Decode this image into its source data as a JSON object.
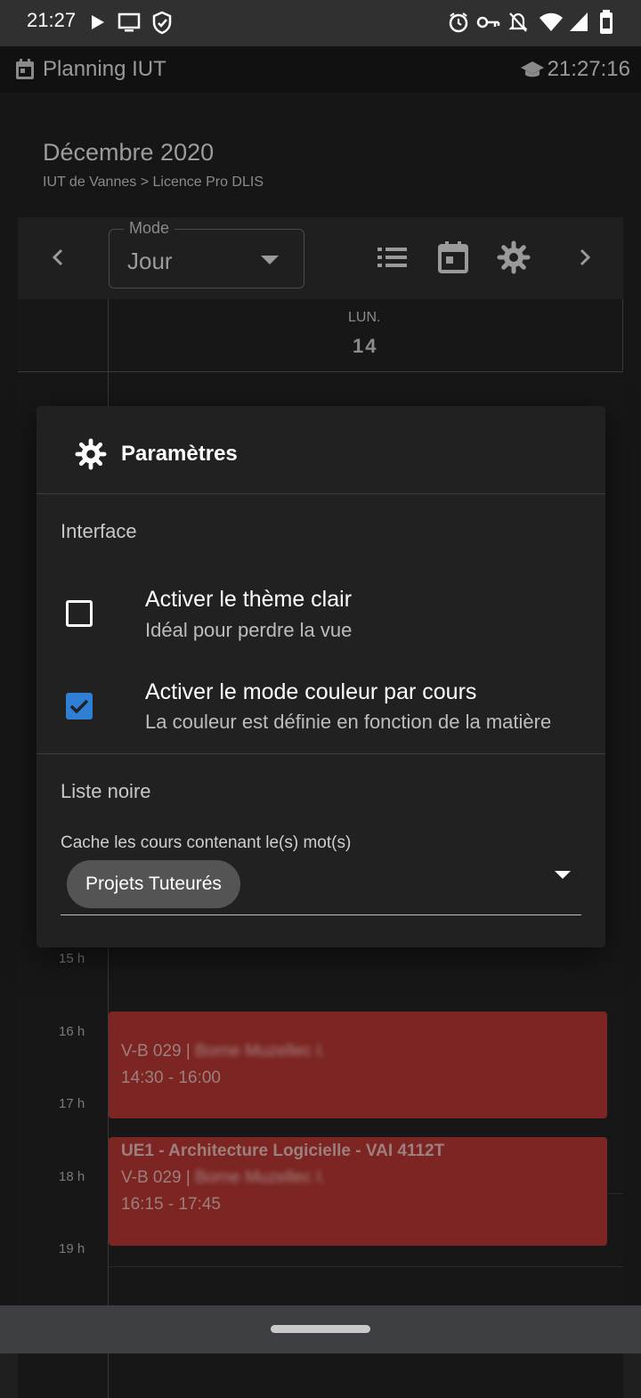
{
  "status_bar": {
    "time": "21:27",
    "icons_left": [
      "play-icon",
      "cast-icon",
      "shield-icon"
    ],
    "icons_right": [
      "alarm-icon",
      "vpn-key-icon",
      "notifications-off-icon",
      "wifi-icon",
      "signal-icon",
      "battery-icon"
    ]
  },
  "app_bar": {
    "title": "Planning IUT",
    "clock": "21:27:16"
  },
  "header": {
    "month": "Décembre 2020",
    "breadcrumb": "IUT de Vannes > Licence Pro DLIS"
  },
  "toolbar": {
    "mode_label": "Mode",
    "mode_value": "Jour"
  },
  "calendar": {
    "day_name": "LUN.",
    "day_number": "14",
    "hours": [
      "15 h",
      "16 h",
      "17 h",
      "18 h",
      "19 h"
    ],
    "events": [
      {
        "title": "",
        "room": "V-B 029 |",
        "teacher": "Borne Muzellec I.",
        "time": "14:30 - 16:00"
      },
      {
        "title": "UE1 - Architecture Logicielle - VAI 4112T",
        "room": "V-B 029 |",
        "teacher": "Borne Muzellec I.",
        "time": "16:15 - 17:45"
      }
    ]
  },
  "dialog": {
    "title": "Paramètres",
    "section_interface": "Interface",
    "options": [
      {
        "title": "Activer le thème clair",
        "subtitle": "Idéal pour perdre la vue",
        "checked": false
      },
      {
        "title": "Activer le mode couleur par cours",
        "subtitle": "La couleur est définie en fonction de la matière",
        "checked": true
      }
    ],
    "section_blacklist": "Liste noire",
    "blacklist_label": "Cache les cours contenant le(s) mot(s)",
    "blacklist_chip": "Projets Tuteurés"
  },
  "colors": {
    "accent": "#2f7fd6",
    "event": "#7c2522"
  }
}
